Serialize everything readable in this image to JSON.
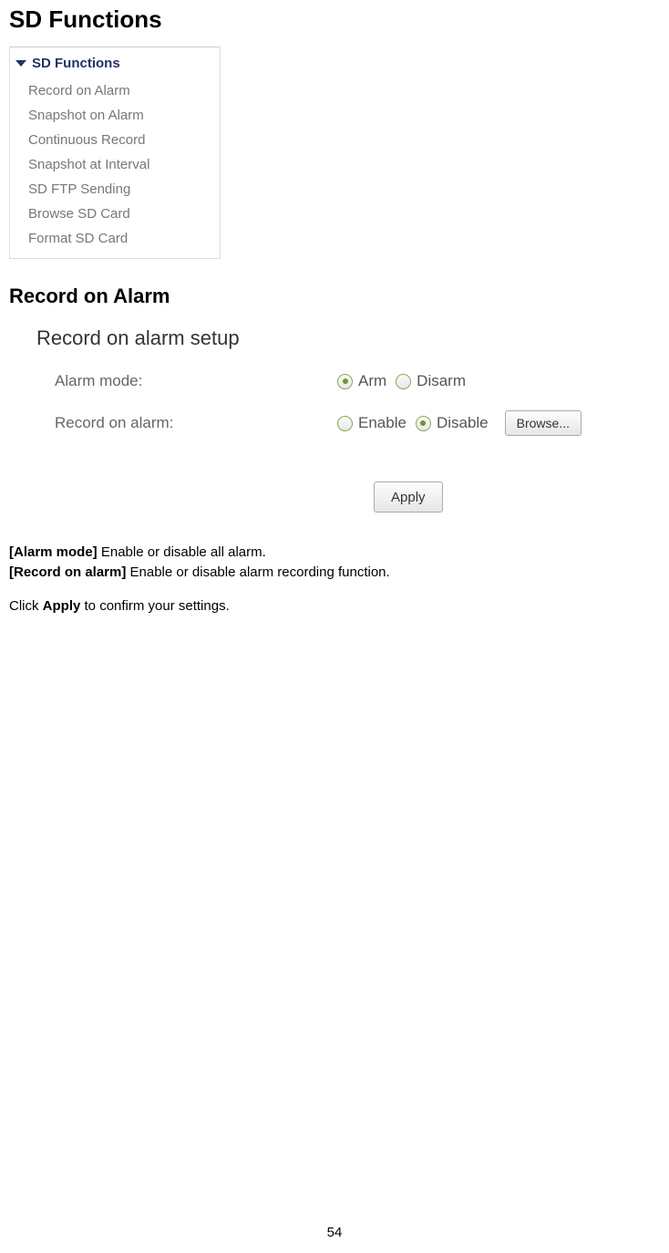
{
  "heading_main": "SD Functions",
  "menu": {
    "header": "SD Functions",
    "items": [
      "Record on Alarm",
      "Snapshot on Alarm",
      "Continuous Record",
      "Snapshot at Interval",
      "SD FTP Sending",
      "Browse SD Card",
      "Format SD Card"
    ]
  },
  "heading_sub": "Record on Alarm",
  "setup": {
    "title": "Record on alarm setup",
    "rows": {
      "alarm_mode": {
        "label": "Alarm mode:",
        "option_arm": "Arm",
        "option_disarm": "Disarm"
      },
      "record_on_alarm": {
        "label": "Record on alarm:",
        "option_enable": "Enable",
        "option_disable": "Disable",
        "browse_label": "Browse..."
      }
    },
    "apply_label": "Apply"
  },
  "description": {
    "line1_bold": "[Alarm mode]",
    "line1_rest": " Enable or disable all alarm.",
    "line2_bold": "[Record on alarm]",
    "line2_rest": " Enable or disable alarm recording function.",
    "line3_pre": "Click ",
    "line3_bold": "Apply",
    "line3_post": " to confirm your settings."
  },
  "page_number": "54"
}
